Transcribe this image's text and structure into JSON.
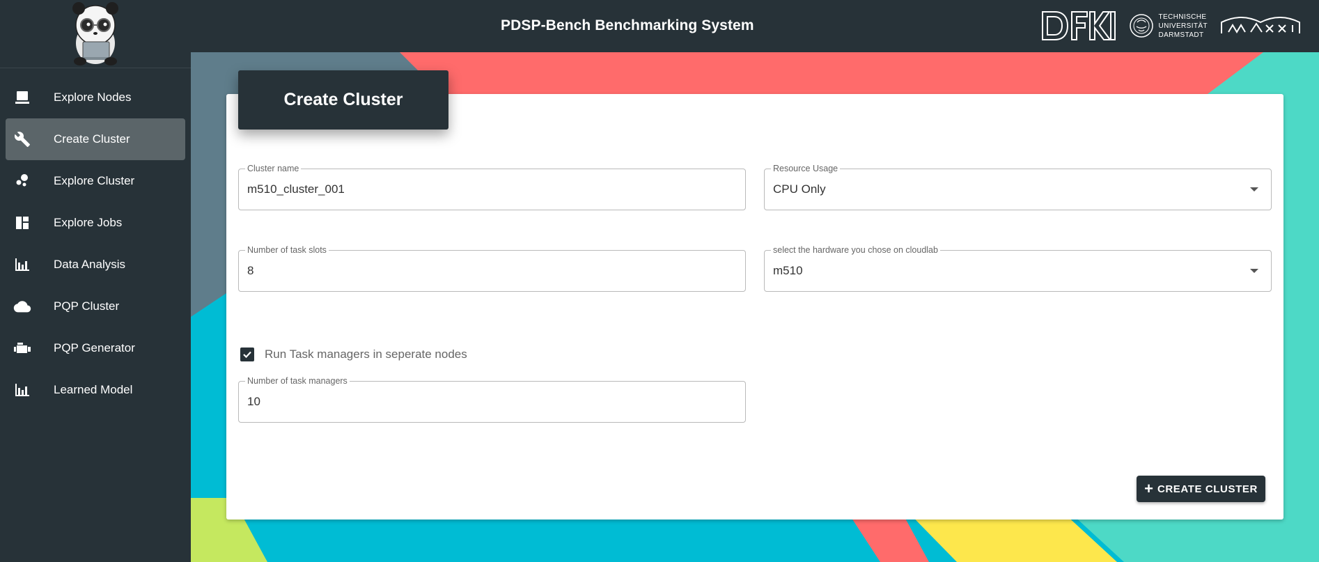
{
  "app": {
    "title": "PDSP-Bench Benchmarking System"
  },
  "header_logos": {
    "dfki": "dfki-logo",
    "tu_lines": [
      "TECHNISCHE",
      "UNIVERSITÄT",
      "DARMSTADT"
    ],
    "third": "maxxi-logo"
  },
  "sidebar": {
    "items": [
      {
        "label": "Explore Nodes",
        "icon": "computer-icon",
        "active": false
      },
      {
        "label": "Create Cluster",
        "icon": "wrench-icon",
        "active": true
      },
      {
        "label": "Explore Cluster",
        "icon": "bubble-chart-icon",
        "active": false
      },
      {
        "label": "Explore Jobs",
        "icon": "dashboard-icon",
        "active": false
      },
      {
        "label": "Data Analysis",
        "icon": "bar-chart-icon",
        "active": false
      },
      {
        "label": "PQP Cluster",
        "icon": "cloud-icon",
        "active": false
      },
      {
        "label": "PQP Generator",
        "icon": "engine-icon",
        "active": false
      },
      {
        "label": "Learned Model",
        "icon": "bar-chart-icon",
        "active": false
      }
    ]
  },
  "form": {
    "title": "Create Cluster",
    "cluster_name": {
      "label": "Cluster name",
      "value": "m510_cluster_001"
    },
    "resource_usage": {
      "label": "Resource Usage",
      "value": "CPU Only"
    },
    "task_slots": {
      "label": "Number of task slots",
      "value": "8"
    },
    "hardware": {
      "label": "select the hardware you chose on cloudlab",
      "value": "m510"
    },
    "separate_nodes": {
      "label": "Run Task managers in seperate nodes",
      "checked": true
    },
    "task_managers": {
      "label": "Number of task managers",
      "value": "10"
    },
    "submit": {
      "label": "CREATE CLUSTER",
      "icon": "plus-icon"
    }
  },
  "colors": {
    "dark": "#273238",
    "active_nav": "#5b6569",
    "bg_cyan": "#00bcd4",
    "bg_red": "#ff6b6b",
    "bg_teal": "#4dd9c6",
    "bg_yellow": "#fde74c",
    "bg_lime": "#c5e85f"
  }
}
